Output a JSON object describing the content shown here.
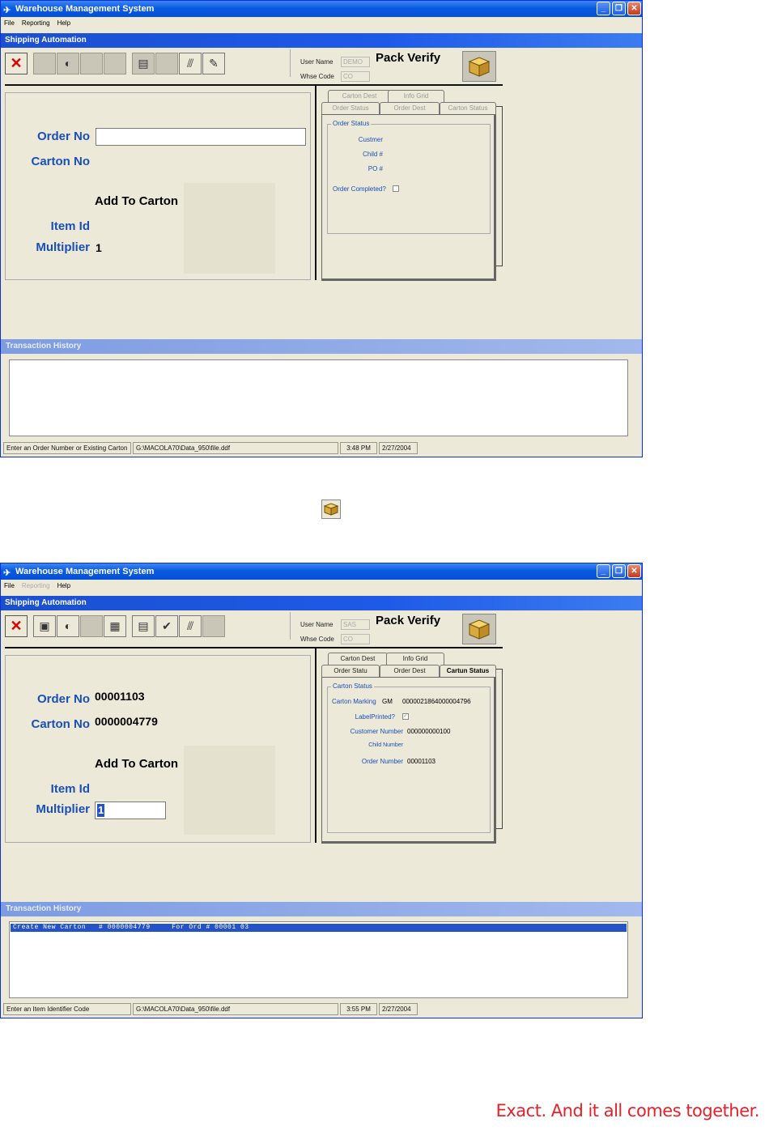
{
  "window_title": "Warehouse Management System",
  "menu": {
    "file": "File",
    "reporting": "Reporting",
    "help": "Help"
  },
  "panel_title": "Shipping Automation",
  "screen1": {
    "user_name_label": "User Name",
    "user_name": "DEMO",
    "whse_code_label": "Whse Code",
    "whse_code": "CO",
    "mode_title": "Pack Verify",
    "order_no_label": "Order No",
    "carton_no_label": "Carton No",
    "add_to_carton": "Add To Carton",
    "item_id_label": "Item Id",
    "multiplier_label": "Multiplier",
    "multiplier_value": "1",
    "tabs": [
      "Carton Dest",
      "Info Grid",
      "Order Status",
      "Order Dest",
      "Carton Status"
    ],
    "group_title": "Order Status",
    "fields": {
      "customer": "Custmer",
      "child": "Child #",
      "po": "PO #",
      "order_completed": "Order Completed?"
    },
    "history_title": "Transaction History",
    "status": {
      "message": "Enter an Order Number or Existing Carton",
      "path": "G:\\MACOLA70\\Data_950\\file.ddf",
      "time": "3:48 PM",
      "date": "2/27/2004"
    }
  },
  "screen2": {
    "user_name_label": "User Name",
    "user_name": "SAS",
    "whse_code_label": "Whse Code",
    "whse_code": "CO",
    "mode_title": "Pack Verify",
    "order_no_label": "Order No",
    "order_no": "00001103",
    "carton_no_label": "Carton No",
    "carton_no": "0000004779",
    "add_to_carton": "Add To Carton",
    "item_id_label": "Item Id",
    "multiplier_label": "Multiplier",
    "multiplier_value": "1",
    "tabs": [
      "Carton Dest",
      "Info Grid",
      "Order Statu",
      "Order Dest",
      "Cartun Status"
    ],
    "group_title": "Carton Status",
    "fields": {
      "carton_marking_label": "Carton Marking",
      "carton_marking_code": "GM",
      "carton_marking_value": "0000021864000004796",
      "label_printed_label": "LabelPrinted?",
      "label_printed": "✓",
      "customer_number_label": "Customer Number",
      "customer_number": "000000000100",
      "child_number_label": "Child Number",
      "order_number_label": "Order Number",
      "order_number": "00001103"
    },
    "history_title": "Transaction History",
    "history_rows": [
      "Create New Carton   # 0000004779     For Ord # 00001 03"
    ],
    "status": {
      "message": "Enter an Item Identifier Code",
      "path": "G:\\MACOLA70\\Data_950\\file.ddf",
      "time": "3:55 PM",
      "date": "2/27/2004"
    }
  },
  "footer_tagline": "Exact. And it all comes together.",
  "colors": {
    "title_bar": "#0A5BE0",
    "label_blue": "#1A4FB8",
    "close_red": "#C5391C",
    "tagline_red": "#E8202A"
  }
}
